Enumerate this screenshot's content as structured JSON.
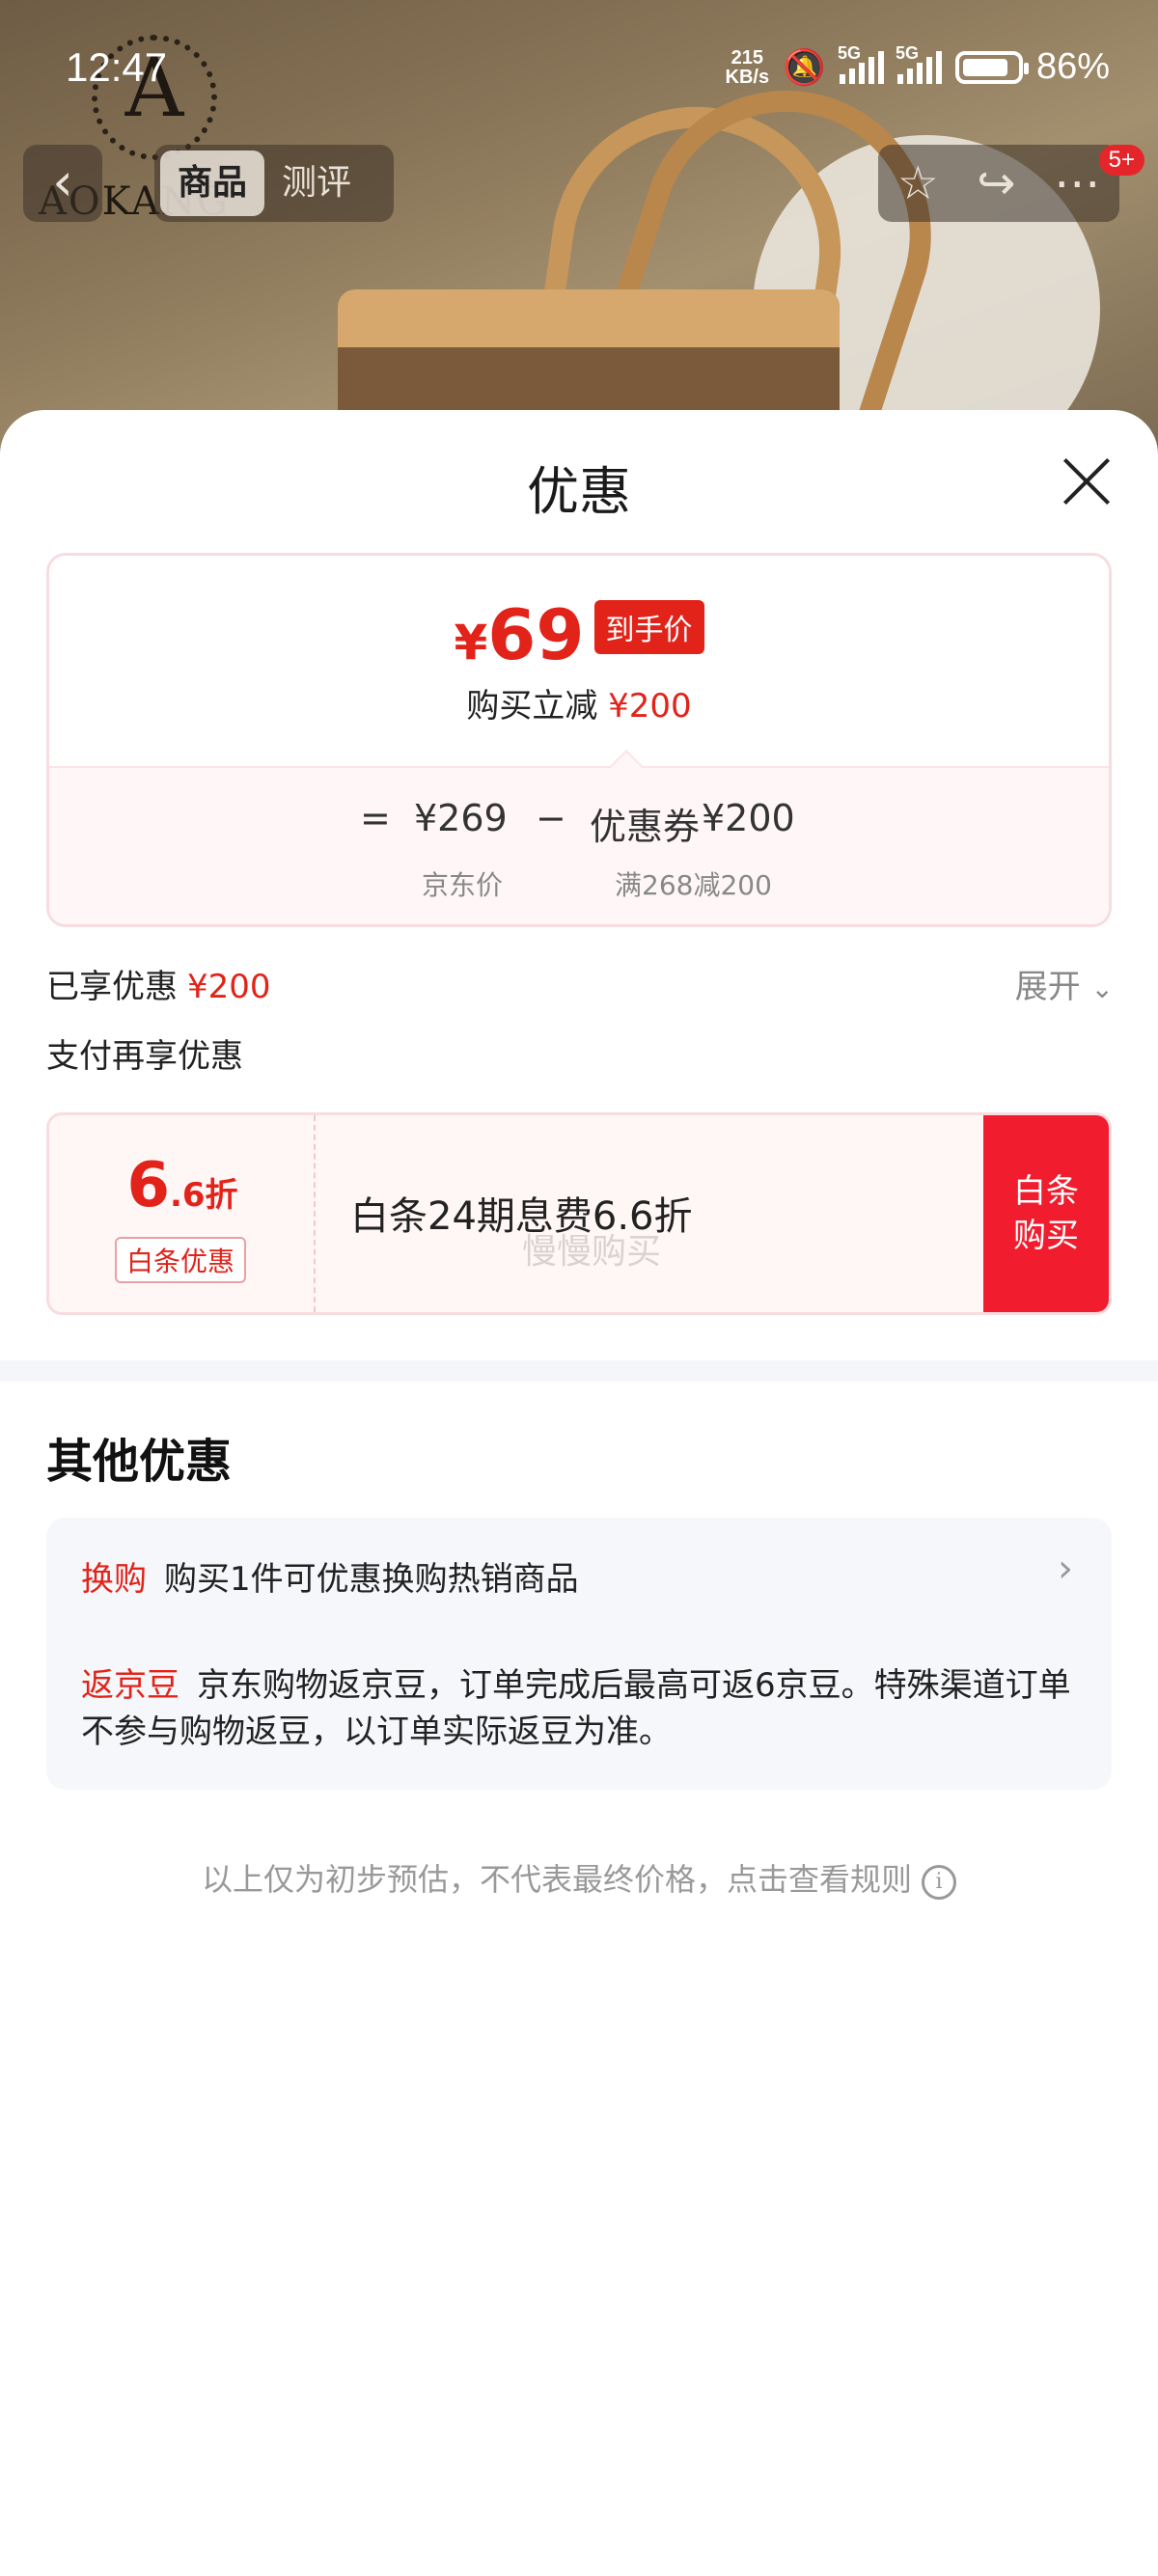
{
  "status_bar": {
    "time": "12:47",
    "net_speed_top": "215",
    "net_speed_bottom": "KB/s",
    "signal1": "5G",
    "signal2": "5G",
    "battery": "86%"
  },
  "background": {
    "logo_letter": "A",
    "logo_word": "AOKANG"
  },
  "nav": {
    "tab_product": "商品",
    "tab_review": "测评",
    "badge": "5+"
  },
  "sheet": {
    "title": "优惠",
    "price_card": {
      "currency": "¥",
      "final_price": "69",
      "final_tag": "到手价",
      "reduce_label": "购买立减",
      "reduce_amount": "¥200",
      "equals": "=",
      "jd_price": "¥269",
      "minus": "−",
      "coupon_label": "优惠券",
      "coupon_amount": "¥200",
      "jd_price_label": "京东价",
      "coupon_condition": "满268减200"
    },
    "enjoyed_label": "已享优惠",
    "enjoyed_amount": "¥200",
    "expand_label": "展开",
    "pay_more_label": "支付再享优惠",
    "baitiao": {
      "discount_big": "6",
      "discount_small": ".6折",
      "tag": "白条优惠",
      "text": "白条24期息费6.6折",
      "watermark": "慢慢购买",
      "button_line1": "白条",
      "button_line2": "购买"
    },
    "other_title": "其他优惠",
    "other": {
      "exchange_label": "换购",
      "exchange_text": "购买1件可优惠换购热销商品",
      "bean_label": "返京豆",
      "bean_text": "京东购物返京豆，订单完成后最高可返6京豆。特殊渠道订单不参与购物返豆，以订单实际返豆为准。"
    },
    "footnote": "以上仅为初步预估，不代表最终价格，点击查看规则"
  }
}
